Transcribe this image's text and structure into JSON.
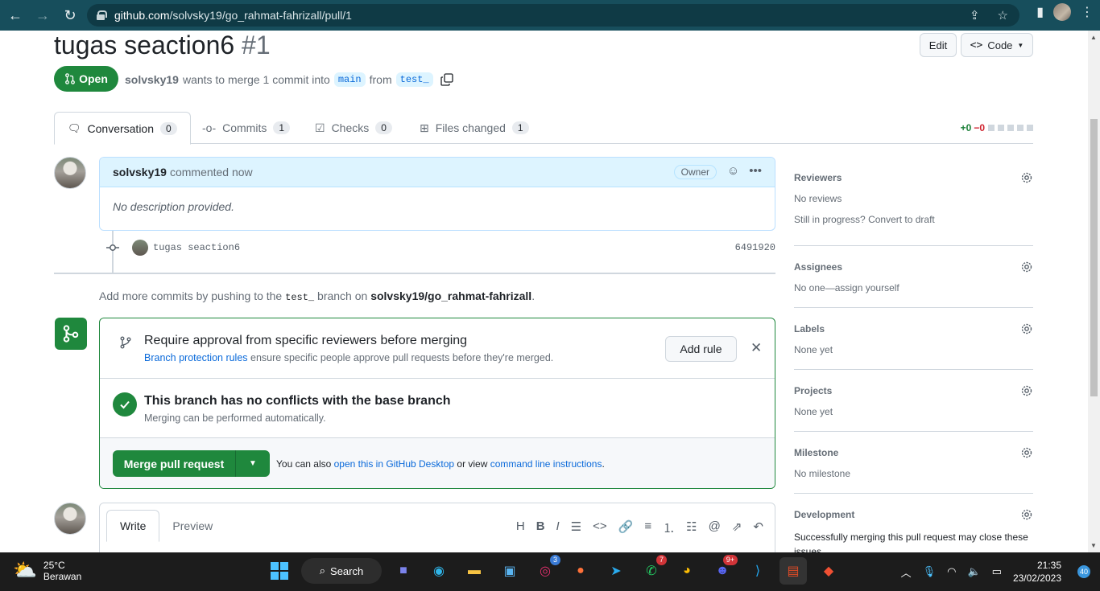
{
  "browser": {
    "url_host": "github.com",
    "url_path": "/solvsky19/go_rahmat-fahrizall/pull/1"
  },
  "pr": {
    "title": "tugas seaction6",
    "number": "#1",
    "state": "Open",
    "author": "solvsky19",
    "meta_text_1": "wants to merge 1 commit into",
    "base_branch": "main",
    "meta_text_2": "from",
    "head_branch": "test_",
    "edit_label": "Edit",
    "code_label": "Code"
  },
  "tabs": [
    {
      "label": "Conversation",
      "count": "0"
    },
    {
      "label": "Commits",
      "count": "1"
    },
    {
      "label": "Checks",
      "count": "0"
    },
    {
      "label": "Files changed",
      "count": "1"
    }
  ],
  "diffstat": {
    "additions": "+0",
    "deletions": "−0"
  },
  "comment": {
    "author": "solvsky19",
    "action": "commented now",
    "badge": "Owner",
    "body": "No description provided."
  },
  "commit": {
    "message": "tugas seaction6",
    "sha": "6491920"
  },
  "push_note": {
    "text_1": "Add more commits by pushing to the",
    "branch": "test_",
    "text_2": "branch on",
    "repo": "solvsky19/go_rahmat-fahrizall",
    "end": "."
  },
  "merge": {
    "rule_title": "Require approval from specific reviewers before merging",
    "rule_link": "Branch protection rules",
    "rule_text": "ensure specific people approve pull requests before they're merged.",
    "add_rule": "Add rule",
    "conflict_title": "This branch has no conflicts with the base branch",
    "conflict_sub": "Merging can be performed automatically.",
    "merge_button": "Merge pull request",
    "also_1": "You can also",
    "desktop_link": "open this in GitHub Desktop",
    "also_2": "or view",
    "cli_link": "command line instructions",
    "also_end": "."
  },
  "write": {
    "write_tab": "Write",
    "preview_tab": "Preview"
  },
  "sidebar": {
    "reviewers": {
      "title": "Reviewers",
      "value": "No reviews",
      "progress": "Still in progress?",
      "draft_link": "Convert to draft"
    },
    "assignees": {
      "title": "Assignees",
      "value_1": "No one—",
      "link": "assign yourself"
    },
    "labels": {
      "title": "Labels",
      "value": "None yet"
    },
    "projects": {
      "title": "Projects",
      "value": "None yet"
    },
    "milestone": {
      "title": "Milestone",
      "value": "No milestone"
    },
    "development": {
      "title": "Development",
      "value": "Successfully merging this pull request may close these issues."
    }
  },
  "taskbar": {
    "temperature": "25°C",
    "weather": "Berawan",
    "search": "Search",
    "badges": {
      "instagram": "3",
      "whatsapp": "7",
      "discord": "9+"
    },
    "time": "21:35",
    "date": "23/02/2023",
    "notifications": "40"
  }
}
